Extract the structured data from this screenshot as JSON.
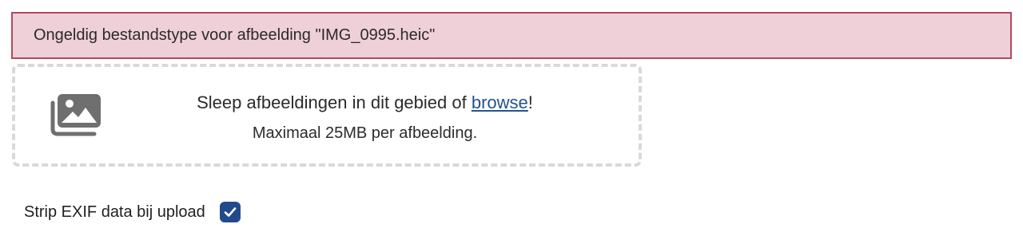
{
  "error_banner": {
    "message": "Ongeldig bestandstype voor afbeelding \"IMG_0995.heic\"",
    "background_color": "#f0d0d8",
    "border_color": "#b0495f"
  },
  "dropzone": {
    "icon": "images-icon",
    "instruction_prefix": "Sleep afbeeldingen in dit gebied of ",
    "browse_label": "browse",
    "instruction_suffix": "!",
    "size_limit": "Maximaal 25MB per afbeelding.",
    "link_color": "#24528f"
  },
  "options": {
    "strip_exif_label": "Strip EXIF data bij upload",
    "strip_exif_checked": true,
    "checkbox_color": "#234b8c"
  }
}
